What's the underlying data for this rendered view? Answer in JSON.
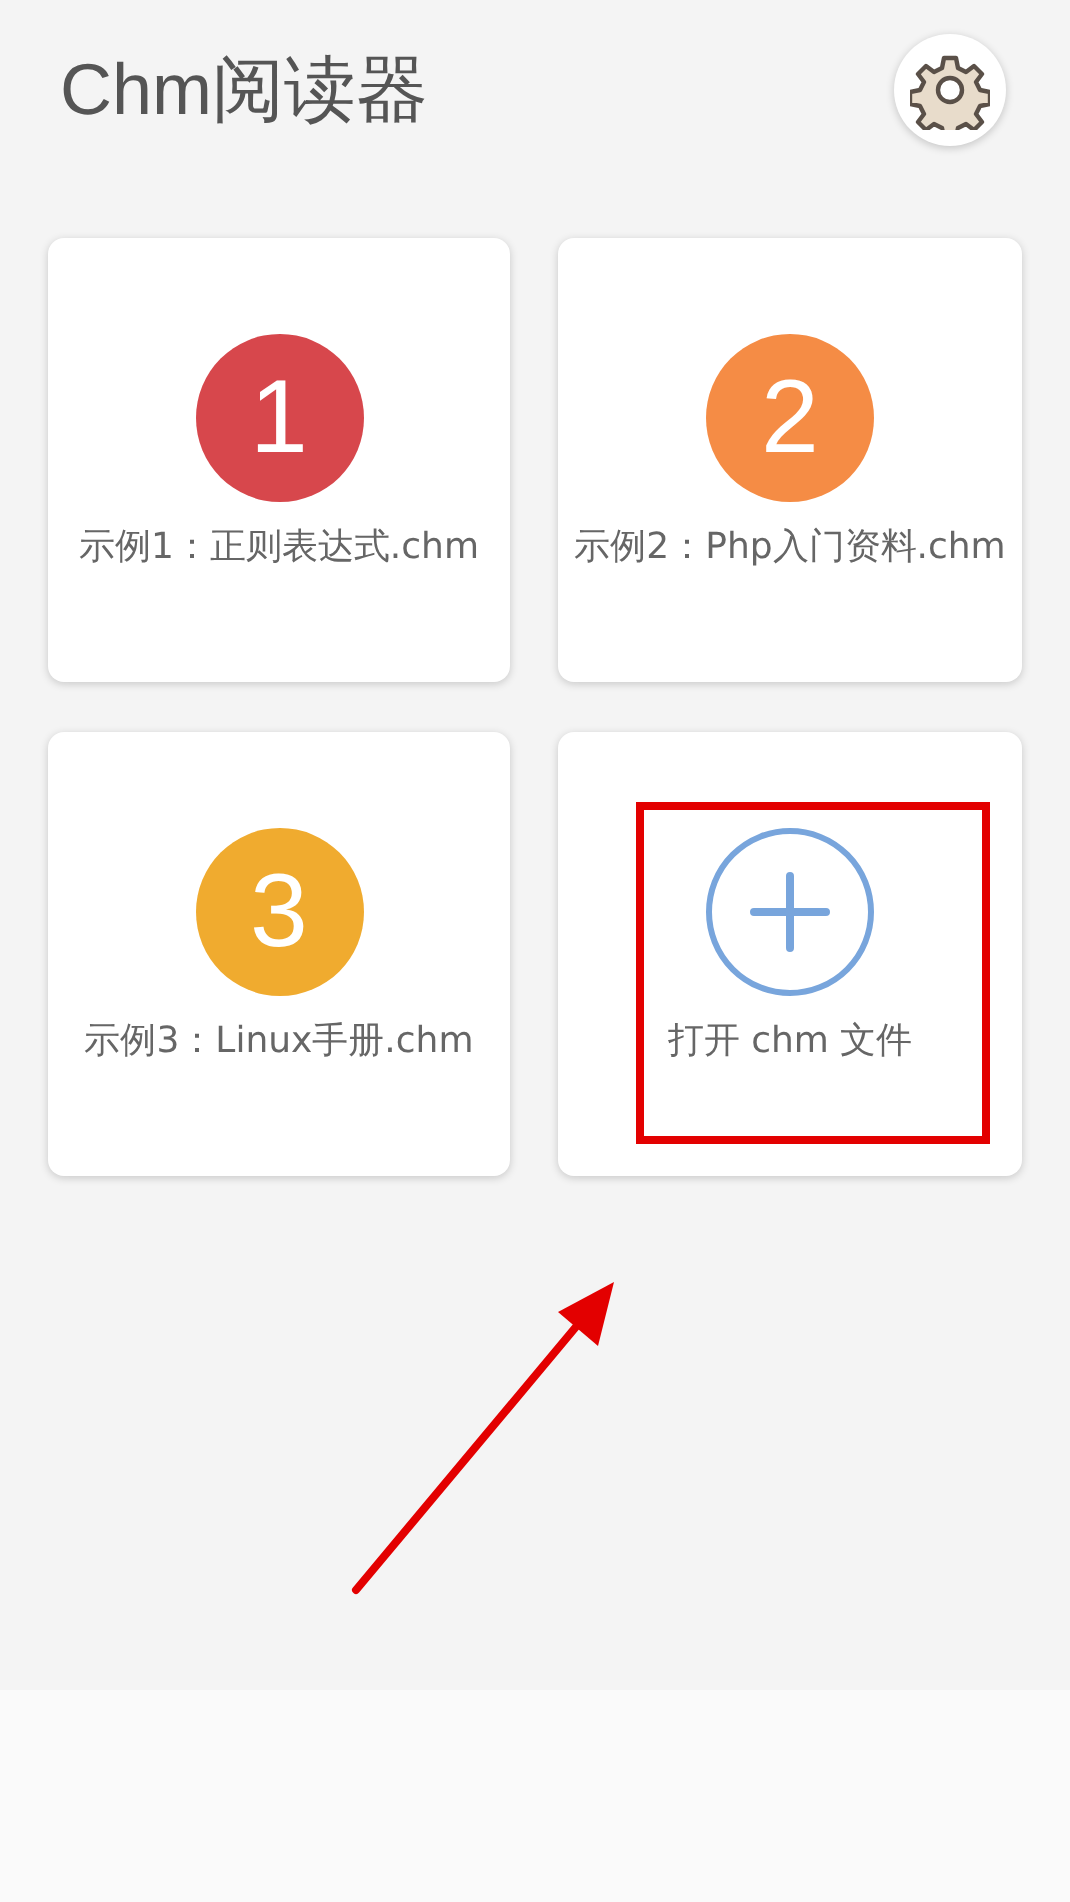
{
  "app_bar": {
    "title": "Chm阅读器"
  },
  "cards": [
    {
      "kind": "number",
      "badge": "1",
      "color": "#d7474c",
      "label": "示例1：正则表达式.chm"
    },
    {
      "kind": "number",
      "badge": "2",
      "color": "#f58c45",
      "label": "示例2：Php入门资料.chm"
    },
    {
      "kind": "number",
      "badge": "3",
      "color": "#f0ab2f",
      "label": "示例3：Linux手册.chm"
    },
    {
      "kind": "add",
      "color": "#78a5dc",
      "label": "打开 chm 文件"
    }
  ]
}
